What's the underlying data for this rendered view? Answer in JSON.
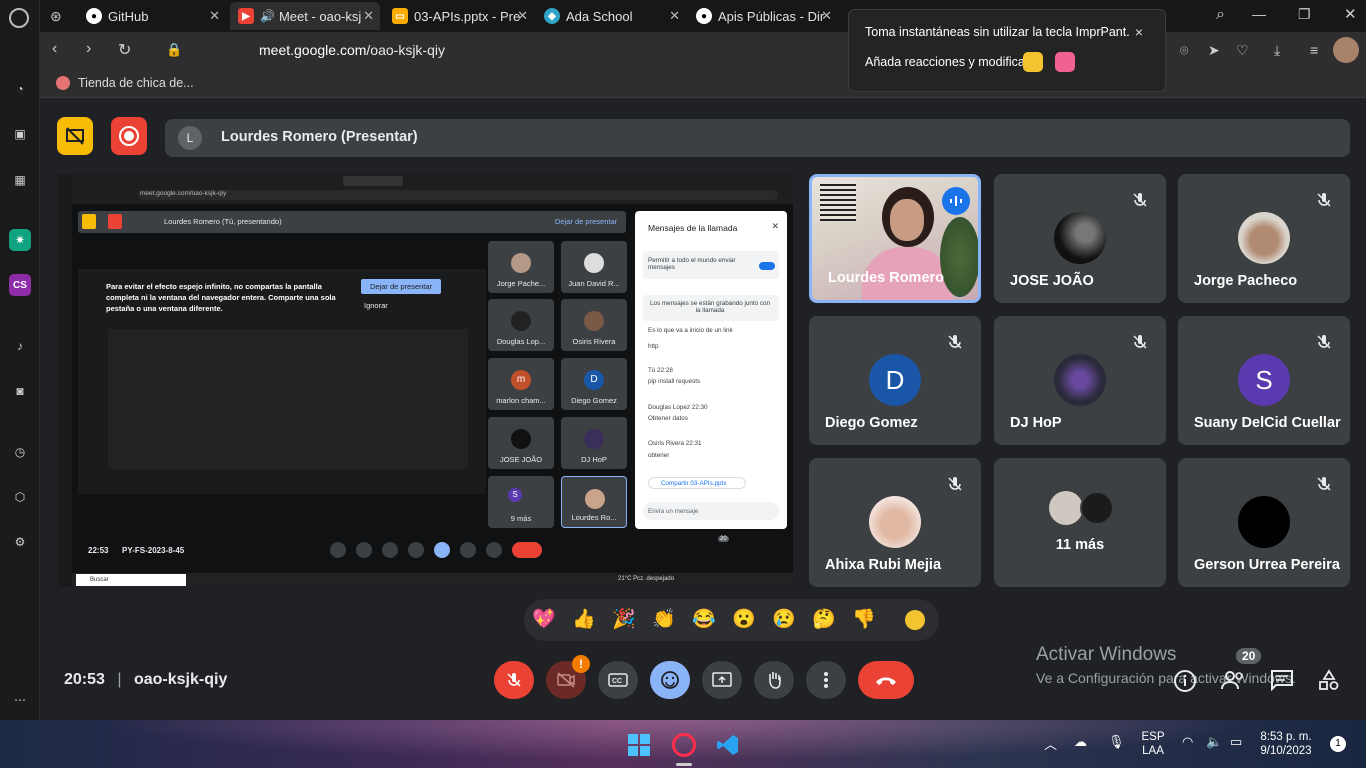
{
  "browser": {
    "tabs": [
      {
        "label": "GitHub",
        "icon": "github-icon"
      },
      {
        "label": "Meet - oao-ksj",
        "icon": "meet-icon"
      },
      {
        "label": "03-APIs.pptx - Pre",
        "icon": "slides-icon"
      },
      {
        "label": "Ada School",
        "icon": "ada-icon"
      },
      {
        "label": "Apis Públicas - Dir",
        "icon": "public-apis-icon"
      }
    ],
    "url_domain": "meet.google.com",
    "url_path": "/oao-ksjk-qiy",
    "bookmark": "Tienda de chica de..."
  },
  "toast": {
    "line1": "Toma instantáneas sin utilizar la tecla ImprPant.",
    "line2": "Añada reacciones y modifica",
    "close": "×"
  },
  "meet": {
    "avatar_letter": "L",
    "presenter_label": "Lourdes Romero (Presentar)",
    "shared_screen": {
      "title": "Lourdes Romero (Tú, presentando)",
      "stop_label": "Dejar de presentar",
      "warning": "Para evitar el efecto espejo infinito, no compartas la pantalla completa ni la ventana del navegador entera. Comparte una sola pestaña o una ventana diferente.",
      "warning_stop": "Dejar de presentar",
      "warning_ignore": "Ignorar",
      "time": "22:53",
      "code": "PY-FS-2023-8-45",
      "badge": "20",
      "taskbar_search": "Buscar",
      "weather": "21°C Pcz. despejado",
      "mini_tiles": [
        "Jorge Pache...",
        "Juan David R...",
        "Douglas Lop...",
        "Osiris Rivera",
        "marlon cham...",
        "Diego Gomez",
        "JOSE JOÃO",
        "DJ HoP",
        "9 más",
        "Lourdes Ro..."
      ],
      "mini_letters": {
        "m": "m",
        "D": "D",
        "S": "S"
      },
      "chat": {
        "title": "Mensajes de la llamada",
        "toggle": "Permitir a todo el mundo enviar mensajes",
        "notice": "Los mensajes se están grabando junto con la llamada",
        "lines": [
          "Es lo que va a inicio de un link",
          "http",
          "Tú  22:28",
          "pip install requests",
          "Douglas Lopez  22:30",
          "Obtener datos",
          "Osiris Rivera  22:31",
          "obtener"
        ],
        "share": "Compartir 03-APIs.pptx",
        "input": "Envía un mensaje"
      }
    },
    "participants": [
      {
        "name": "Lourdes Romero",
        "speaking": true
      },
      {
        "name": "JOSE JOÃO"
      },
      {
        "name": "Jorge Pacheco"
      },
      {
        "name": "Diego Gomez",
        "letter": "D",
        "color": "#1a57a8"
      },
      {
        "name": "DJ HoP"
      },
      {
        "name": "Suany DelCid Cuellar",
        "letter": "S",
        "color": "#5b3ab0"
      },
      {
        "name": "Ahixa Rubi Mejia"
      },
      {
        "name": "11 más"
      },
      {
        "name": "Gerson Urrea Pereira"
      }
    ],
    "time": "20:53",
    "separator": "|",
    "code": "oao-ksjk-qiy",
    "people_count": "20",
    "reactions": [
      "💖",
      "👍",
      "🎉",
      "👏",
      "😂",
      "😮",
      "😢",
      "🤔",
      "👎"
    ],
    "alert": "!"
  },
  "watermark": {
    "line1": "Activar Windows",
    "line2": "Ve a Configuración para activar Windows."
  },
  "taskbar": {
    "lang1": "ESP",
    "lang2": "LAA",
    "time": "8:53 p. m.",
    "date": "9/10/2023",
    "notif": "1"
  }
}
